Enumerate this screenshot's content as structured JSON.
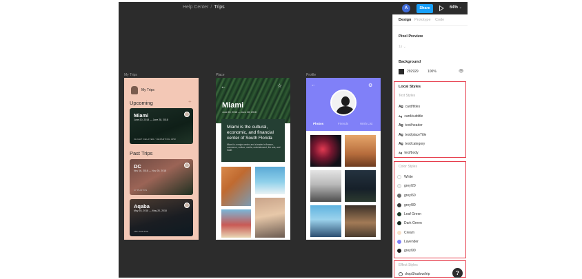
{
  "topbar": {
    "breadcrumb_parent": "Help Center",
    "breadcrumb_sep": "/",
    "breadcrumb_current": "Trips",
    "avatar_initial": "A",
    "share_label": "Share",
    "zoom": "64%",
    "play_icon": "play-icon"
  },
  "canvas": {
    "background": "#2c2c2c",
    "frames": [
      {
        "label": "My Trips",
        "title": "My Trips",
        "upcoming_heading": "Upcoming",
        "add_symbol": "+",
        "past_heading": "Past Trips",
        "cards": [
          {
            "city": "Miami",
            "dates": "June 20, 2018 — June 28, 2018",
            "meta": "FLIGHT DELAYED / DEPARTING 4PM"
          },
          {
            "city": "DC",
            "dates": "Nov 16, 2018 — Nov 20, 2018",
            "meta": "47 PHOTOS"
          },
          {
            "city": "Aqaba",
            "dates": "May 16, 2018 — May 20, 2018",
            "meta": "152 PHOTOS"
          }
        ]
      },
      {
        "label": "Place",
        "title": "Miami",
        "dates": "June 20, 2018 — June 28, 2018",
        "tagline": "Miami is the cultural, economic, and financial center of South Florida",
        "description": "Miami is a major center, and a leader in finance, commerce, culture, media, entertainment, the arts, and trade."
      },
      {
        "label": "Profile",
        "tabs": [
          "Photos",
          "Friends",
          "Wish List"
        ]
      }
    ]
  },
  "panel": {
    "tabs": [
      "Design",
      "Prototype",
      "Code"
    ],
    "pixel_preview": {
      "title": "Pixel Preview",
      "value": "1x"
    },
    "background": {
      "title": "Background",
      "hex": "292929",
      "opacity": "100%"
    },
    "local_styles": {
      "title": "Local Styles",
      "text_styles_title": "Text Styles",
      "text_styles": [
        {
          "glyph": "Ag",
          "name": "card/titles"
        },
        {
          "glyph": "Ag",
          "name": "card/subtitle"
        },
        {
          "glyph": "Ag",
          "name": "text/header"
        },
        {
          "glyph": "Ag",
          "name": "text/placeTitle"
        },
        {
          "glyph": "Ag",
          "name": "text/category"
        },
        {
          "glyph": "Ag",
          "name": "text/body"
        }
      ],
      "color_styles_title": "Color Styles",
      "color_styles": [
        {
          "name": "White",
          "color": "#ffffff"
        },
        {
          "name": "grey/20",
          "color": "#f2f2f2"
        },
        {
          "name": "grey/60",
          "color": "#6b6b6b"
        },
        {
          "name": "grey/80",
          "color": "#3a3a3a"
        },
        {
          "name": "Leaf Green",
          "color": "#1f3a28"
        },
        {
          "name": "Dark Green",
          "color": "#17281f"
        },
        {
          "name": "Cream",
          "color": "#f7dfc7"
        },
        {
          "name": "Lavender",
          "color": "#8080f8"
        },
        {
          "name": "grey/90",
          "color": "#1c1c1c"
        }
      ],
      "effect_styles_title": "Effect Styles",
      "effect_styles": [
        {
          "name": "dropShadow/trip"
        }
      ]
    },
    "help_symbol": "?"
  },
  "accent_colors": {
    "share": "#18a0fb",
    "highlight": "#e63b4a"
  }
}
